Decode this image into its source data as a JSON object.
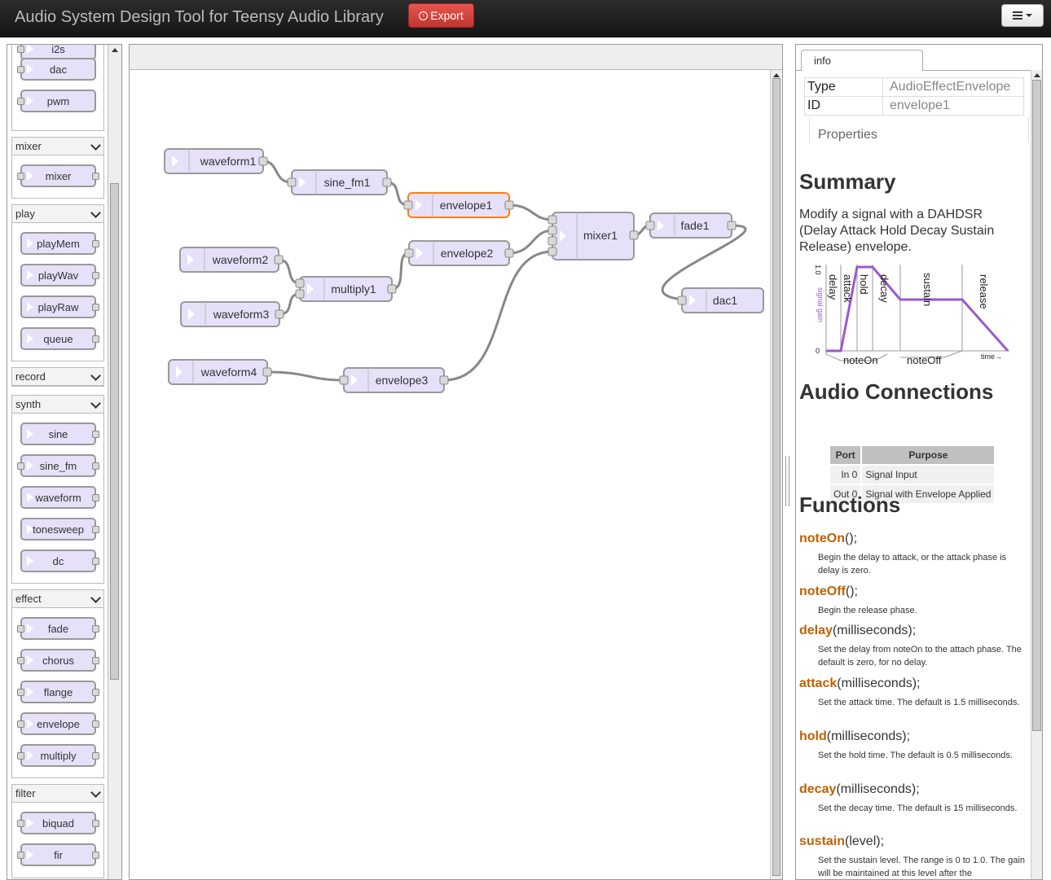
{
  "header": {
    "title": "Audio System Design Tool for Teensy Audio Library",
    "export_label": "Export"
  },
  "palette": {
    "categories": [
      {
        "name": "mixer"
      },
      {
        "name": "play"
      },
      {
        "name": "record"
      },
      {
        "name": "synth"
      },
      {
        "name": "effect"
      },
      {
        "name": "filter"
      }
    ],
    "top_nodes": [
      "i2s",
      "dac",
      "pwm"
    ],
    "mixer": [
      "mixer"
    ],
    "play": [
      "playMem",
      "playWav",
      "playRaw",
      "queue"
    ],
    "synth": [
      "sine",
      "sine_fm",
      "waveform",
      "tonesweep",
      "dc"
    ],
    "effect": [
      "fade",
      "chorus",
      "flange",
      "envelope",
      "multiply"
    ],
    "filter": [
      "biquad",
      "fir"
    ]
  },
  "flow": {
    "nodes": [
      "waveform1",
      "sine_fm1",
      "envelope1",
      "waveform2",
      "waveform3",
      "multiply1",
      "envelope2",
      "waveform4",
      "envelope3",
      "mixer1",
      "fade1",
      "dac1"
    ],
    "selected": "envelope1"
  },
  "sidebar": {
    "tab": "info",
    "props": {
      "type_label": "Type",
      "type_value": "AudioEffectEnvelope",
      "id_label": "ID",
      "id_value": "envelope1",
      "properties_label": "Properties"
    },
    "summary_heading": "Summary",
    "summary_text": "Modify a signal with a DAHDSR (Delay Attack Hold Decay Sustain Release) envelope.",
    "diagram": {
      "phases": [
        "delay",
        "attack",
        "hold",
        "decay",
        "sustain",
        "release"
      ],
      "y_top": "1.0",
      "y_bottom": "0",
      "y_label": "signal gain",
      "x_label": "time→",
      "markers": [
        "noteOn",
        "noteOff"
      ]
    },
    "connections_heading": "Audio Connections",
    "connections": {
      "headers": [
        "Port",
        "Purpose"
      ],
      "rows": [
        {
          "port": "In 0",
          "purpose": "Signal Input"
        },
        {
          "port": "Out 0",
          "purpose": "Signal with Envelope Applied"
        }
      ]
    },
    "functions_heading": "Functions",
    "functions": [
      {
        "name": "noteOn",
        "args": "();",
        "desc": "Begin the delay to attack, or the attack phase is delay is zero."
      },
      {
        "name": "noteOff",
        "args": "();",
        "desc": "Begin the release phase."
      },
      {
        "name": "delay",
        "args": "(milliseconds);",
        "desc": "Set the delay from noteOn to the attach phase. The default is zero, for no delay."
      },
      {
        "name": "attack",
        "args": "(milliseconds);",
        "desc": "Set the attack time. The default is 1.5 milliseconds."
      },
      {
        "name": "hold",
        "args": "(milliseconds);",
        "desc": "Set the hold time. The default is 0.5 milliseconds."
      },
      {
        "name": "decay",
        "args": "(milliseconds);",
        "desc": "Set the decay time. The default is 15 milliseconds."
      },
      {
        "name": "sustain",
        "args": "(level);",
        "desc": "Set the sustain level. The range is 0 to 1.0. The gain will be maintained at this level after the"
      }
    ]
  },
  "colors": {
    "node_fill": "#e6e0f8",
    "selected_border": "#ff7f0e",
    "function_name": "#c06000",
    "envelope_line": "#9b59d0",
    "export_button": "#da4f49"
  }
}
